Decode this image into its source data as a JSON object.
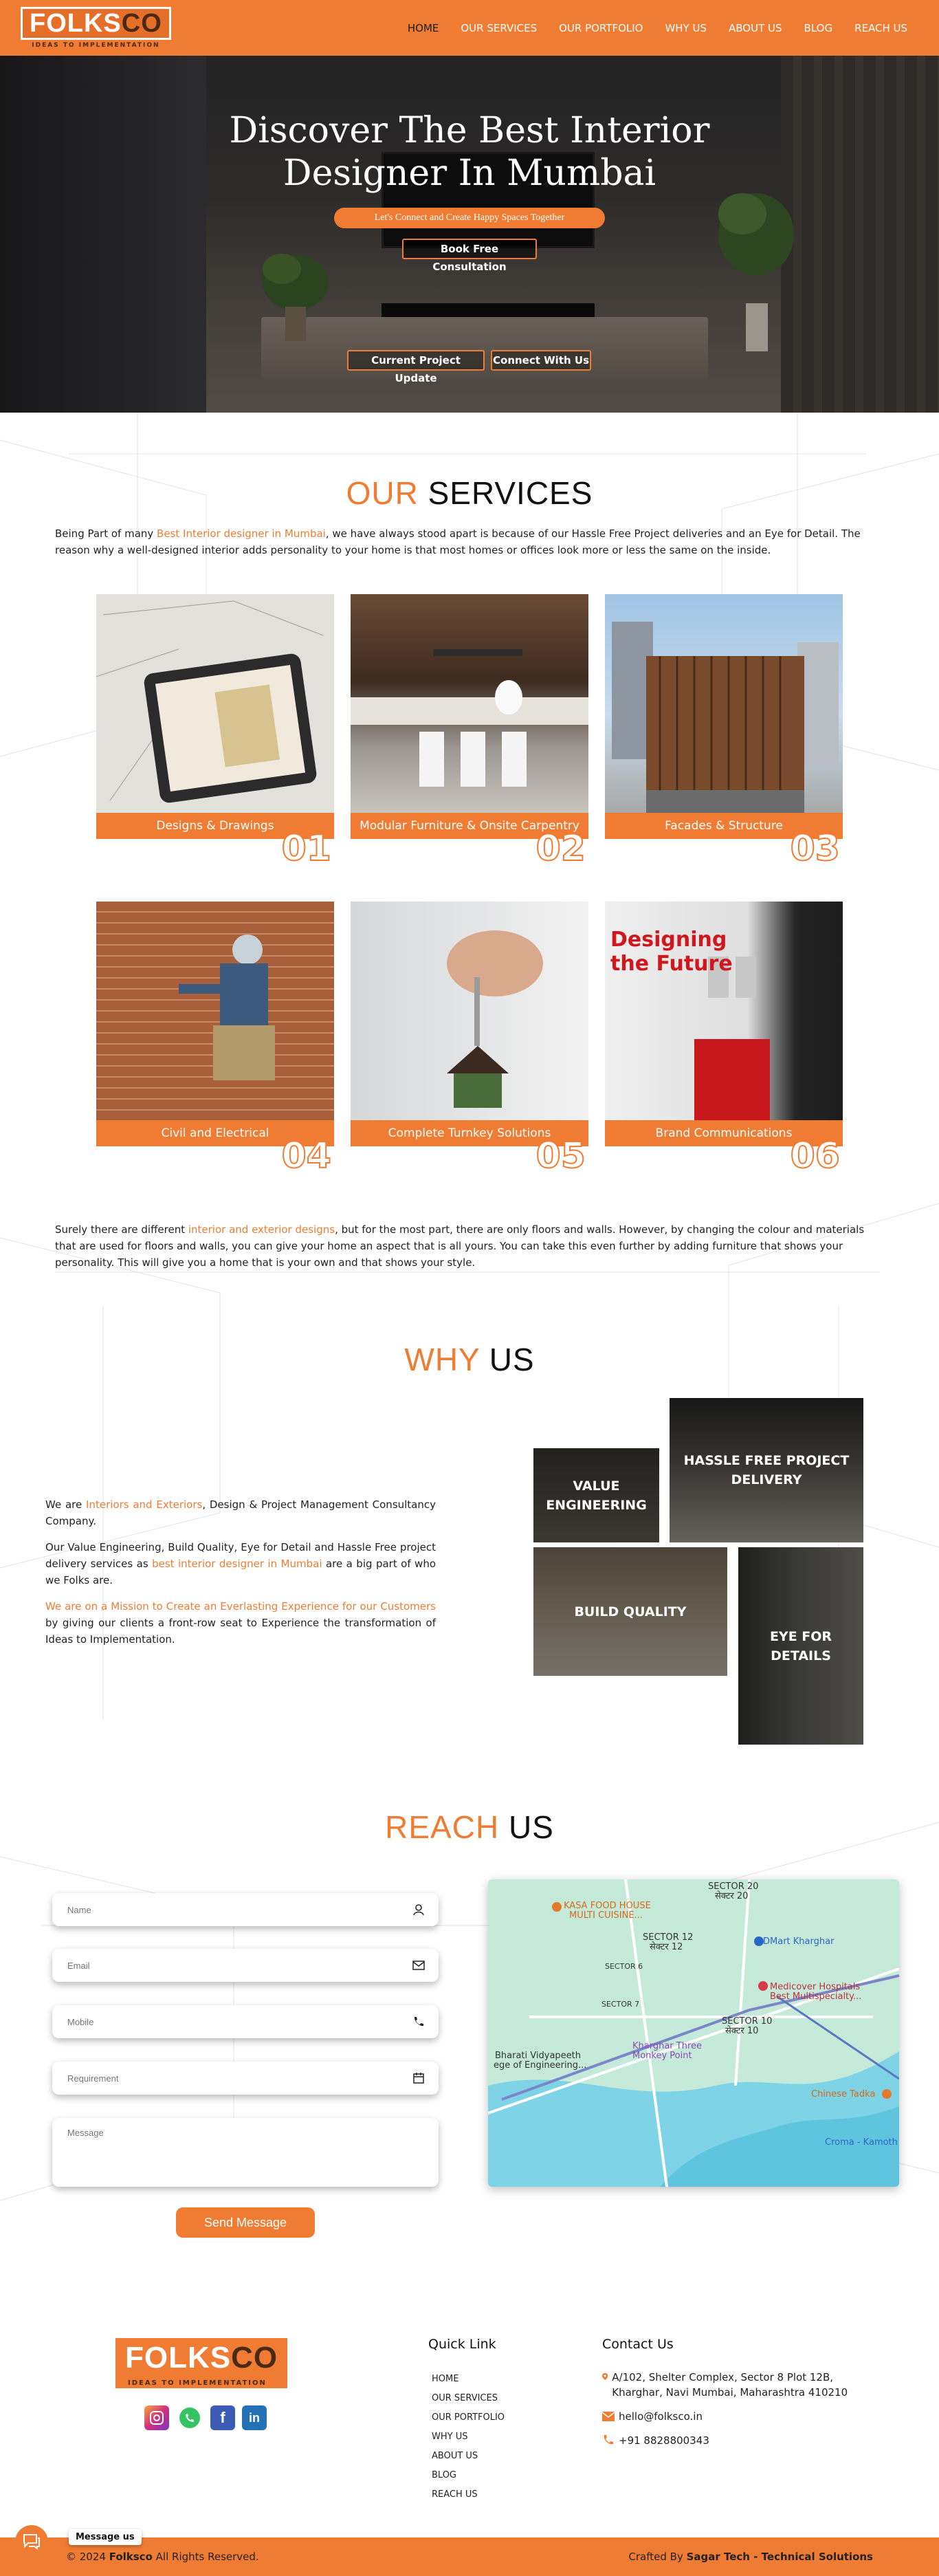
{
  "nav": {
    "logo_text_a": "FOLKS",
    "logo_text_b": "CO",
    "logo_tagline": "IDEAS TO IMPLEMENTATION",
    "items": [
      {
        "label": "HOME",
        "active": true
      },
      {
        "label": "OUR SERVICES",
        "active": false
      },
      {
        "label": "OUR PORTFOLIO",
        "active": false
      },
      {
        "label": "WHY US",
        "active": false
      },
      {
        "label": "ABOUT US",
        "active": false
      },
      {
        "label": "BLOG",
        "active": false
      },
      {
        "label": "REACH US",
        "active": false
      }
    ]
  },
  "hero": {
    "title_line1": "Discover The Best Interior",
    "title_line2": "Designer In Mumbai",
    "tagline": "Let's Connect and Create Happy Spaces Together",
    "cta": "Book Free Consultation",
    "btn_update": "Current Project Update",
    "btn_connect": "Connect With Us"
  },
  "services": {
    "title_accent": "OUR",
    "title_dark": "SERVICES",
    "intro_a": "Being Part of many ",
    "intro_link": "Best Interior designer in Mumbai",
    "intro_b": ", we have always stood apart is because of our Hassle Free Project deliveries and an Eye for Detail. The reason why a well-designed interior adds personality to your home is that most homes or offices look more or less the same on the inside.",
    "items": [
      {
        "label": "Designs & Drawings",
        "num": "01"
      },
      {
        "label": "Modular Furniture & Onsite Carpentry",
        "num": "02"
      },
      {
        "label": "Facades & Structure",
        "num": "03"
      },
      {
        "label": "Civil and Electrical",
        "num": "04"
      },
      {
        "label": "Complete Turnkey Solutions",
        "num": "05"
      },
      {
        "label": "Brand Communications",
        "num": "06"
      }
    ],
    "designing_sign_1": "Designing",
    "designing_sign_2": "the Future",
    "outro_a": "Surely there are different ",
    "outro_link": "interior and exterior designs",
    "outro_b": ", but for the most part, there are only floors and walls. However, by changing the colour and materials that are used for floors and walls, you can give your home an aspect that is all yours. You can take this even further by adding furniture that shows your personality. This will give you a home that is your own and that shows your style."
  },
  "why": {
    "title_accent": "WHY",
    "title_dark": "US",
    "p1_a": "We are ",
    "p1_link": "Interiors and Exteriors",
    "p1_b": ", Design & Project Management Consultancy Company.",
    "p2_a": "Our Value Engineering, Build Quality, Eye for Detail and Hassle Free project delivery services as ",
    "p2_link": "best interior designer in Mumbai",
    "p2_b": " are a big part of who we Folks are.",
    "p3_link": "We are on a Mission to Create an Everlasting Experience for our Customers",
    "p3_b": " by giving our clients a front-row seat to Experience the transformation of Ideas to Implementation.",
    "tiles": {
      "value": "VALUE ENGINEERING",
      "hassle": "HASSLE FREE PROJECT DELIVERY",
      "build": "BUILD QUALITY",
      "eye": "EYE FOR DETAILS"
    }
  },
  "reach": {
    "title_accent": "REACH",
    "title_dark": "US",
    "placeholders": {
      "name": "Name",
      "email": "Email",
      "mobile": "Mobile",
      "requirement": "Requirement",
      "message": "Message"
    },
    "send": "Send Message",
    "map_labels": {
      "kasa": "KASA FOOD HOUSE",
      "kasa2": "MULTI CUISINE...",
      "sector20": "SECTOR 20",
      "sector20m": "सेक्टर 20",
      "sector12": "SECTOR 12",
      "sector12m": "सेक्टर 12",
      "sector6": "SECTOR 6",
      "sector7": "SECTOR 7",
      "sector10": "SECTOR 10",
      "sector10m": "सेक्टर 10",
      "dmart": "DMart Kharghar",
      "medicover": "Medicover Hospitals",
      "medicover2": "Best Multispecialty...",
      "bharati": "Bharati Vidyapeeth",
      "bharati2": "ege of Engineering...",
      "kharghar": "Kharghar Three",
      "kharghar2": "Monkey Point",
      "chinese": "Chinese Tadka",
      "croma": "Croma - Kamoth"
    }
  },
  "footer": {
    "quick_title": "Quick Link",
    "quick_links": [
      "HOME",
      "OUR SERVICES",
      "OUR PORTFOLIO",
      "WHY US",
      "ABOUT US",
      "BLOG",
      "REACH US"
    ],
    "contact_title": "Contact Us",
    "address": "A/102, Shelter Complex, Sector 8 Plot 12B, Kharghar, Navi Mumbai, Maharashtra 410210",
    "email": "hello@folksco.in",
    "phone": "+91 8828800343",
    "copyright_a": "© 2024 ",
    "copyright_brand": "Folksco",
    "copyright_b": " All Rights Reserved.",
    "crafted_a": "Crafted By ",
    "crafted_b": "Sagar Tech - Technical Solutions",
    "chat_tip": "Message us"
  },
  "colors": {
    "accent": "#f07c33",
    "dark": "#111111"
  }
}
